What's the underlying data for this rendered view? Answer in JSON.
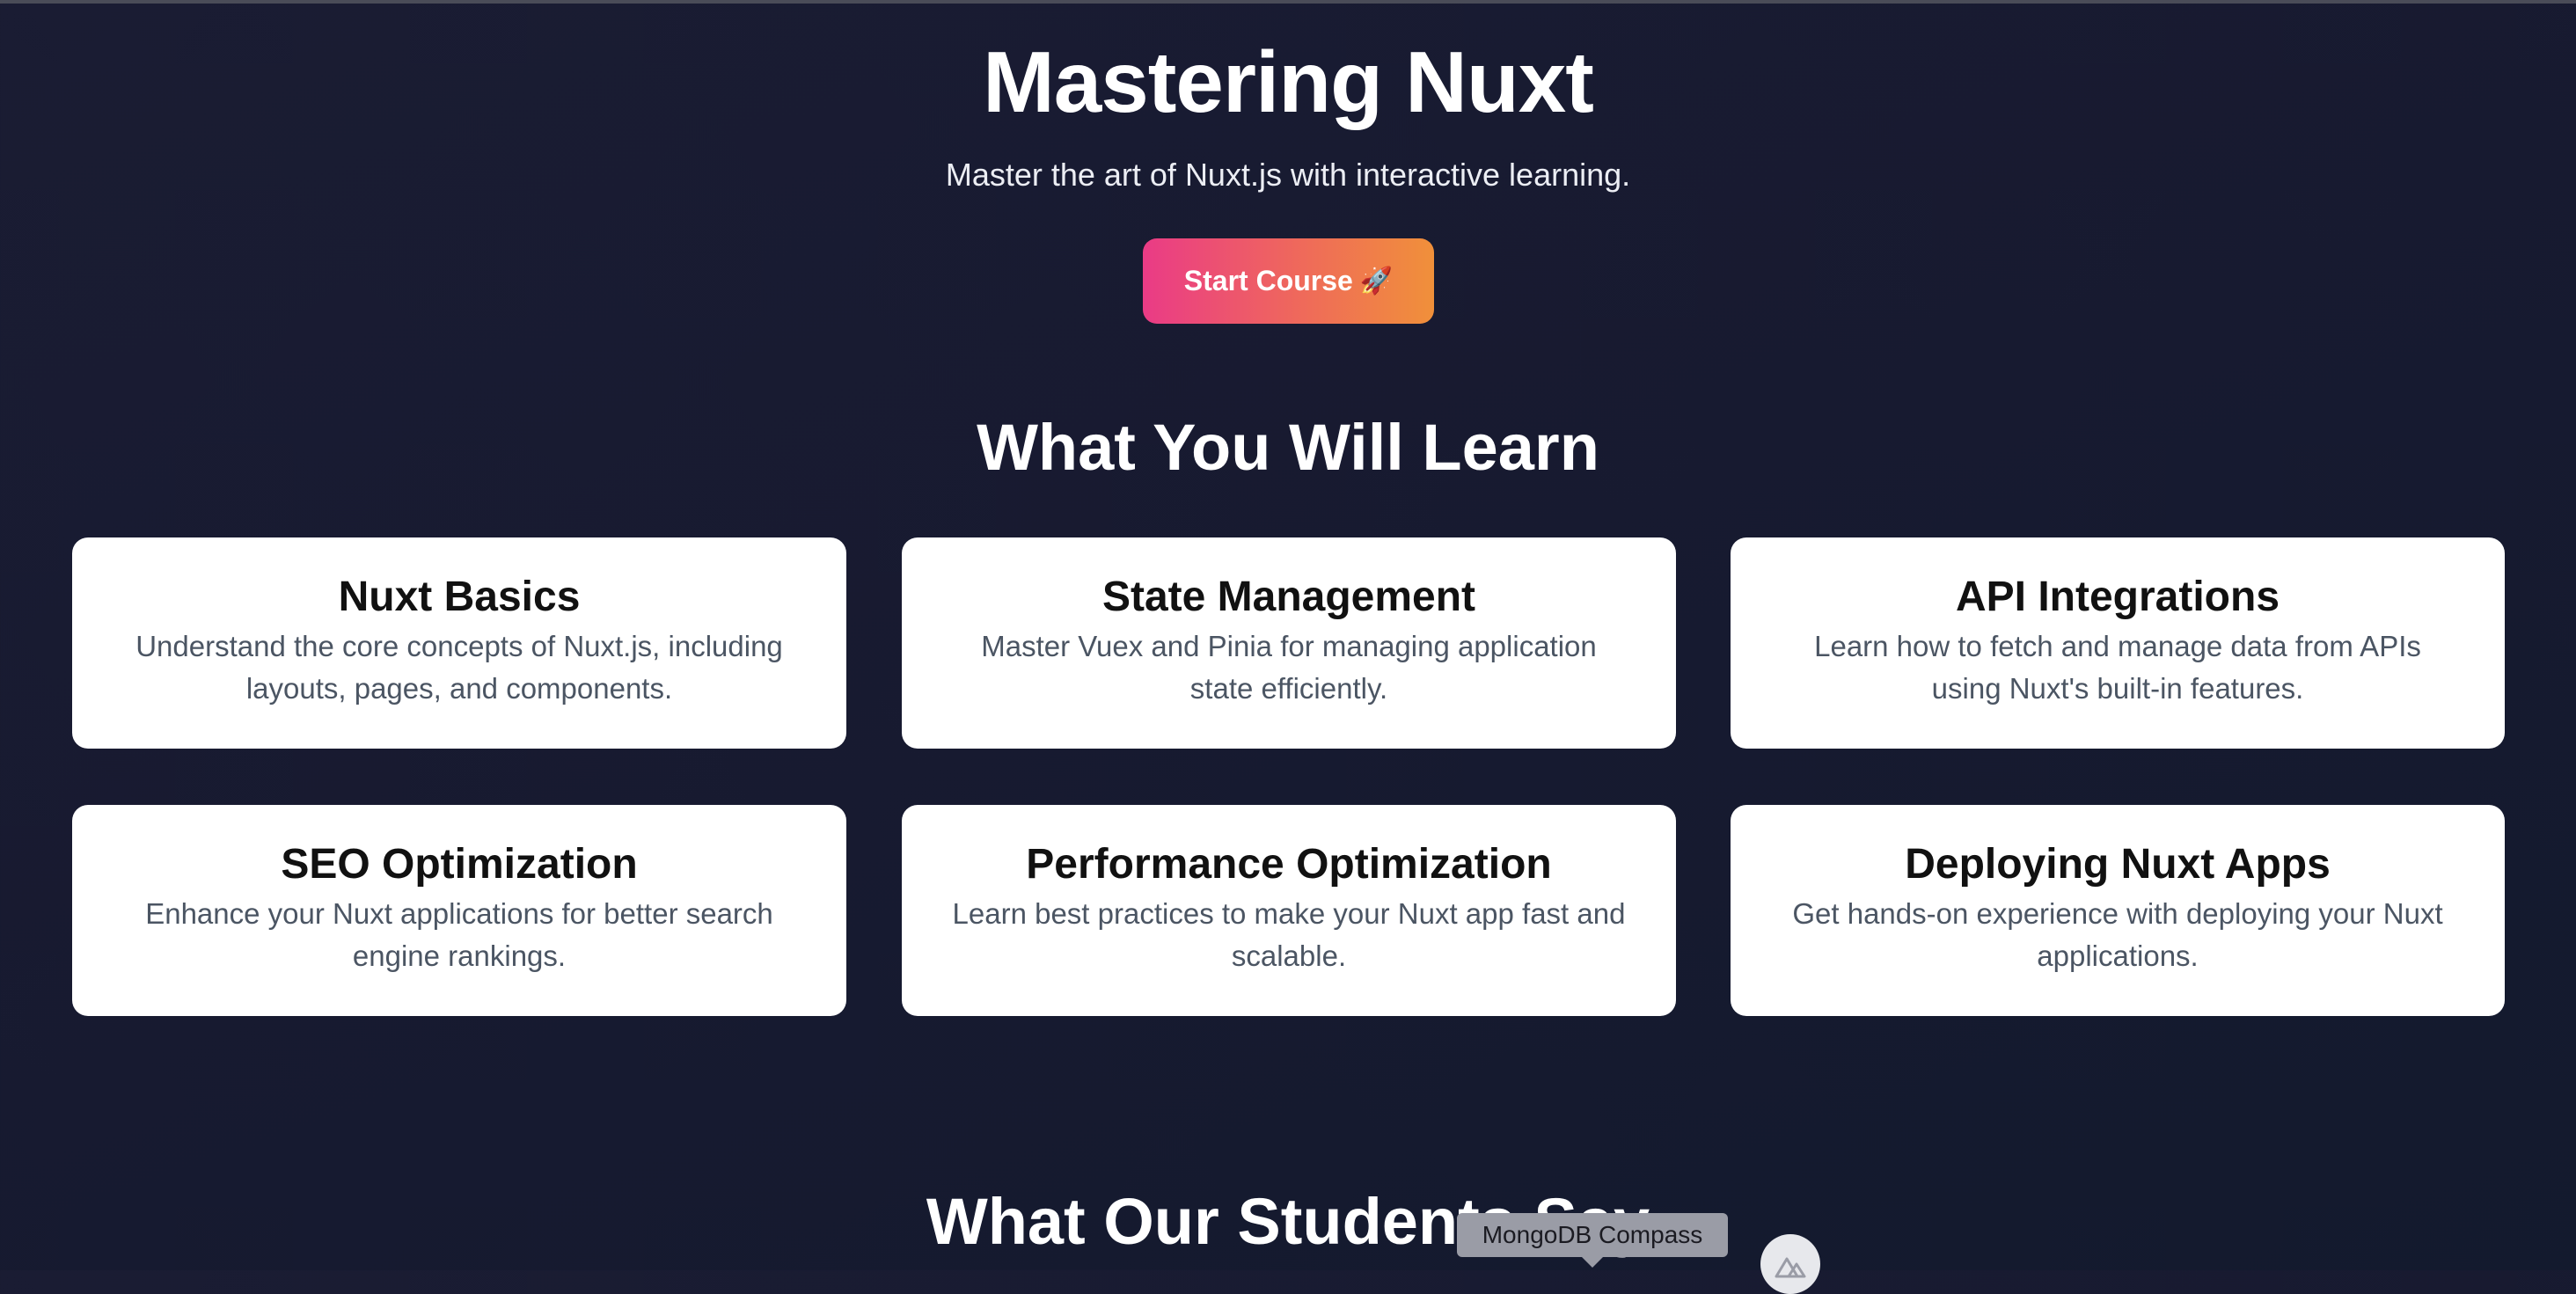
{
  "hero": {
    "title": "Mastering Nuxt",
    "subtitle": "Master the art of Nuxt.js with interactive learning.",
    "cta_label": "Start Course",
    "cta_icon": "🚀"
  },
  "learn_section": {
    "title": "What You Will Learn",
    "cards": [
      {
        "title": "Nuxt Basics",
        "description": "Understand the core concepts of Nuxt.js, including layouts, pages, and components."
      },
      {
        "title": "State Management",
        "description": "Master Vuex and Pinia for managing application state efficiently."
      },
      {
        "title": "API Integrations",
        "description": "Learn how to fetch and manage data from APIs using Nuxt's built-in features."
      },
      {
        "title": "SEO Optimization",
        "description": "Enhance your Nuxt applications for better search engine rankings."
      },
      {
        "title": "Performance Optimization",
        "description": "Learn best practices to make your Nuxt app fast and scalable."
      },
      {
        "title": "Deploying Nuxt Apps",
        "description": "Get hands-on experience with deploying your Nuxt applications."
      }
    ]
  },
  "students_section": {
    "title": "What Our Students Say"
  },
  "dock": {
    "tooltip": "MongoDB Compass",
    "icon": "nuxt-logo-icon"
  },
  "colors": {
    "background": "#171a30",
    "card_background": "#ffffff",
    "button_gradient_start": "#ea3b86",
    "button_gradient_end": "#f0903a"
  }
}
